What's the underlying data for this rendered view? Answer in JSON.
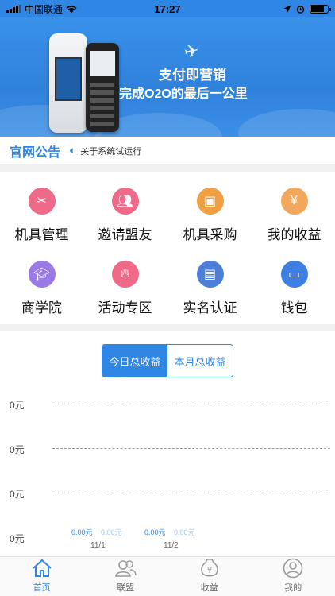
{
  "status": {
    "carrier": "中国联通",
    "time": "17:27"
  },
  "banner": {
    "line1": "支付即营销",
    "line2": "完成O2O的最后一公里"
  },
  "notice": {
    "title": "官网公告",
    "text": "关于系统试运行"
  },
  "grid": [
    {
      "label": "机具管理",
      "icon": "tools-icon",
      "color": "#ef6a88"
    },
    {
      "label": "邀请盟友",
      "icon": "users-icon",
      "color": "#ef6a88"
    },
    {
      "label": "机具采购",
      "icon": "box-icon",
      "color": "#f0a043"
    },
    {
      "label": "我的收益",
      "icon": "yen-bag-icon",
      "color": "#f3a75c"
    },
    {
      "label": "商学院",
      "icon": "graduation-cap-icon",
      "color": "#9a7ae6"
    },
    {
      "label": "活动专区",
      "icon": "flame-icon",
      "color": "#ef6a88"
    },
    {
      "label": "实名认证",
      "icon": "id-card-icon",
      "color": "#4d7fd9"
    },
    {
      "label": "钱包",
      "icon": "wallet-icon",
      "color": "#3d7fe2"
    }
  ],
  "earnings": {
    "tab_today": "今日总收益",
    "tab_month": "本月总收益"
  },
  "chart_data": {
    "type": "bar",
    "categories": [
      "11/1",
      "11/2"
    ],
    "series": [
      {
        "values": [
          0,
          0
        ],
        "labels": [
          "0.00元",
          "0.00元"
        ]
      },
      {
        "values": [
          0,
          0
        ],
        "labels": [
          "0.00元",
          "0.00元"
        ]
      }
    ],
    "y_ticks": [
      "0元",
      "0元",
      "0元",
      "0元"
    ]
  },
  "nav": [
    {
      "label": "首页",
      "icon": "home-icon"
    },
    {
      "label": "联盟",
      "icon": "alliance-icon"
    },
    {
      "label": "收益",
      "icon": "earnings-icon"
    },
    {
      "label": "我的",
      "icon": "profile-icon"
    }
  ]
}
